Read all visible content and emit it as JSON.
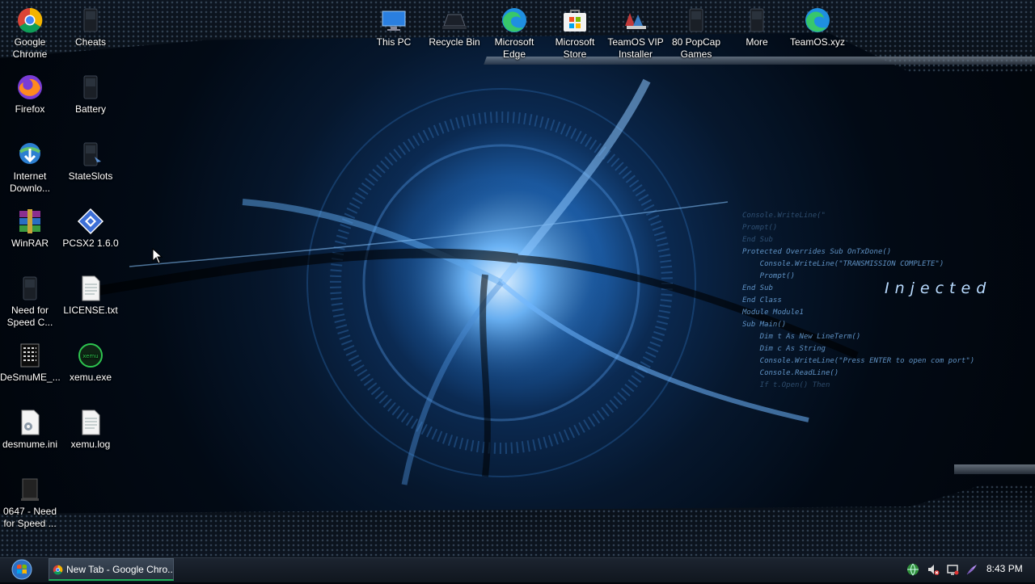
{
  "desktop": {
    "icons_left": [
      {
        "label": "Google Chrome",
        "icon": "chrome-icon"
      },
      {
        "label": "Cheats",
        "icon": "cheats-shortcut-icon"
      },
      {
        "label": "Firefox",
        "icon": "firefox-icon"
      },
      {
        "label": "Battery",
        "icon": "battery-shortcut-icon"
      },
      {
        "label": "Internet Downlo...",
        "icon": "internet-download-manager-icon"
      },
      {
        "label": "StateSlots",
        "icon": "stateslots-shortcut-icon"
      },
      {
        "label": "WinRAR",
        "icon": "winrar-icon"
      },
      {
        "label": "PCSX2 1.6.0",
        "icon": "pcsx2-icon"
      },
      {
        "label": "Need for Speed C...",
        "icon": "need-for-speed-icon"
      },
      {
        "label": "LICENSE.txt",
        "icon": "text-file-icon"
      },
      {
        "label": "DeSmuME_...",
        "icon": "desmume-icon"
      },
      {
        "label": "xemu.exe",
        "icon": "xemu-icon"
      },
      {
        "label": "desmume.ini",
        "icon": "ini-file-icon"
      },
      {
        "label": "xemu.log",
        "icon": "log-file-icon"
      },
      {
        "label": "0647 - Need for Speed ...",
        "icon": "nfs-file-icon"
      }
    ],
    "icons_top": [
      {
        "label": "This PC",
        "icon": "this-pc-icon"
      },
      {
        "label": "Recycle Bin",
        "icon": "recycle-bin-icon"
      },
      {
        "label": "Microsoft Edge",
        "icon": "edge-icon"
      },
      {
        "label": "Microsoft Store",
        "icon": "store-icon"
      },
      {
        "label": "TeamOS VIP Installer",
        "icon": "teamos-installer-icon"
      },
      {
        "label": "80 PopCap Games",
        "icon": "popcap-games-icon"
      },
      {
        "label": "More",
        "icon": "more-folder-icon"
      },
      {
        "label": "TeamOS.xyz",
        "icon": "teamos-edge-icon"
      }
    ]
  },
  "wallpaper": {
    "code_lines": [
      "Protected Overrides Sub OnTxDone()",
      "    Console.WriteLine(\"TRANSMISSION COMPLETE\")",
      "    Prompt()",
      "End Sub",
      "End Class",
      "Module Module1",
      "Sub Main()",
      "    Dim t As New LineTerm()",
      "    Dim c As String",
      "    Console.WriteLine(\"Press ENTER to open com port\")",
      "    Console.ReadLine()",
      "    If t.Open() Then"
    ],
    "faint_lines": [
      "Console.WriteLine(\"",
      "Prompt()",
      "End Sub"
    ],
    "tagline": "Injected"
  },
  "taskbar": {
    "task_label": "New Tab - Google Chro...",
    "clock": "8:43 PM"
  },
  "colors": {
    "accent_blue": "#5fa9f0",
    "taskbar_bg": "#10161e",
    "active_task_underline": "#1fb05a"
  }
}
